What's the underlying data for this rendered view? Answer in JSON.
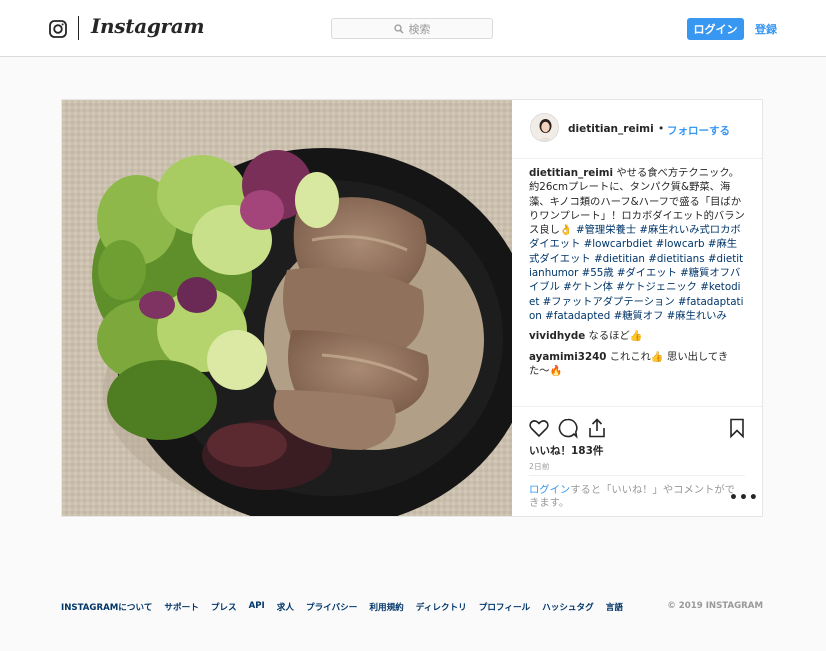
{
  "header": {
    "logo_text": "Instagram",
    "search_placeholder": "検索",
    "login_label": "ログイン",
    "signup_label": "登録"
  },
  "post": {
    "username": "dietitian_reimi",
    "separator": "•",
    "follow_label": "フォローする",
    "caption": {
      "username": "dietitian_reimi",
      "text": " やせる食べ方テクニック。約26cmプレートに、タンパク質&野菜、海藻、キノコ類のハーフ&ハーフで盛る「目ばかりワンプレート」！ロカボダイエット的バランス良し👌",
      "hashtags": "#管理栄養士 #麻生れいみ式ロカボダイエット #lowcarbdiet #lowcarb #麻生式ダイエット #dietitian #dietitians #dietitianhumor #55歳 #ダイエット #糖質オフバイブル #ケトン体 #ケトジェニック #ketodiet #ファットアダプテーション #fatadaptation #fatadapted #糖質オフ #麻生れいみ"
    },
    "comments": [
      {
        "username": "vividhyde",
        "text": " なるほど👍"
      },
      {
        "username": "ayamimi3240",
        "text": " これこれ👍 思い出してきた〜🔥"
      }
    ],
    "likes": "いいね！183件",
    "time": "2日前",
    "add_comment": {
      "login_link": "ログイン",
      "text": "すると「いいね！」やコメントができます。"
    },
    "more_label": "•••",
    "icons": [
      "heart-icon",
      "comment-icon",
      "share-icon",
      "bookmark-icon",
      "more-options-icon"
    ]
  },
  "footer": {
    "links": [
      "INSTAGRAMについて",
      "サポート",
      "プレス",
      "API",
      "求人",
      "プライバシー",
      "利用規約",
      "ディレクトリ",
      "プロフィール",
      "ハッシュタグ",
      "言語"
    ],
    "copyright": "© 2019 INSTAGRAM"
  },
  "colors": {
    "accent": "#3897f0",
    "link_dark": "#003569",
    "border": "#dbdbdb",
    "background": "#fafafa"
  }
}
